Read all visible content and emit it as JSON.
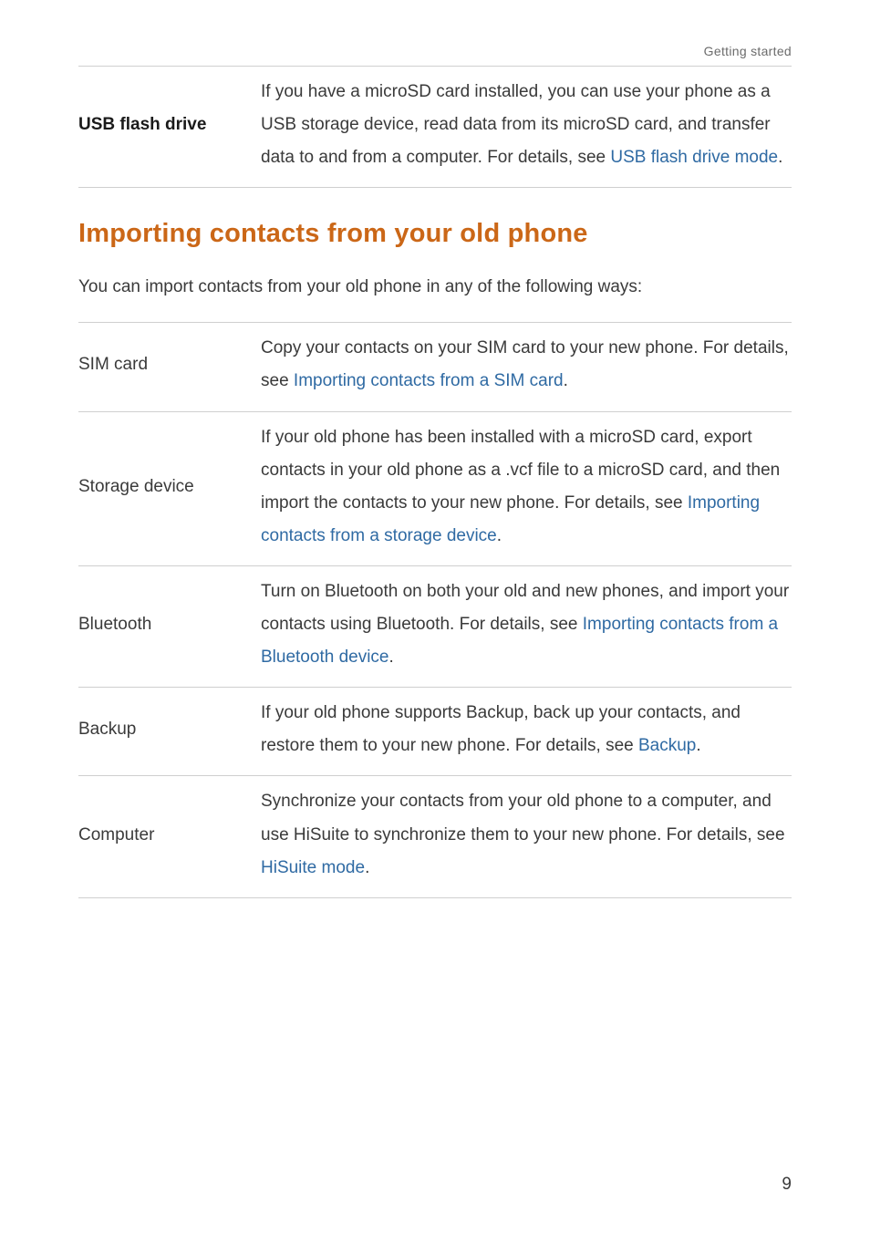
{
  "header": {
    "breadcrumb": "Getting started"
  },
  "usb_row": {
    "label": "USB flash drive",
    "p1": "If you have a microSD card installed, you can use your phone as a USB storage device, read data from its microSD card, and transfer data to and from a computer. For details, see ",
    "link": "USB flash drive mode",
    "after": "."
  },
  "heading": "Importing contacts from your old phone",
  "lead": "You can import contacts from your old phone in any of the following ways:",
  "rows": [
    {
      "label": "SIM card",
      "p1": "Copy your contacts on your SIM card to your new phone. For details, see ",
      "link": "Importing contacts from a SIM card",
      "after": "."
    },
    {
      "label": "Storage device",
      "p1": "If your old phone has been installed with a microSD card, export contacts in your old phone as a .vcf file to a microSD card, and then import the contacts to your new phone. For details, see ",
      "link": "Importing contacts from a storage device",
      "after": "."
    },
    {
      "label": "Bluetooth",
      "p1": "Turn on Bluetooth on both your old and new phones, and import your contacts using Bluetooth. For details, see ",
      "link": "Importing contacts from a Bluetooth device",
      "after": "."
    },
    {
      "label": "Backup",
      "p1": "If your old phone supports Backup, back up your contacts, and restore them to your new phone. For details, see ",
      "link": "Backup",
      "after": "."
    },
    {
      "label": "Computer",
      "p1": "Synchronize your contacts from your old phone to a computer, and use HiSuite to synchronize them to your new phone. For details, see ",
      "link": "HiSuite mode",
      "after": "."
    }
  ],
  "page_number": "9"
}
